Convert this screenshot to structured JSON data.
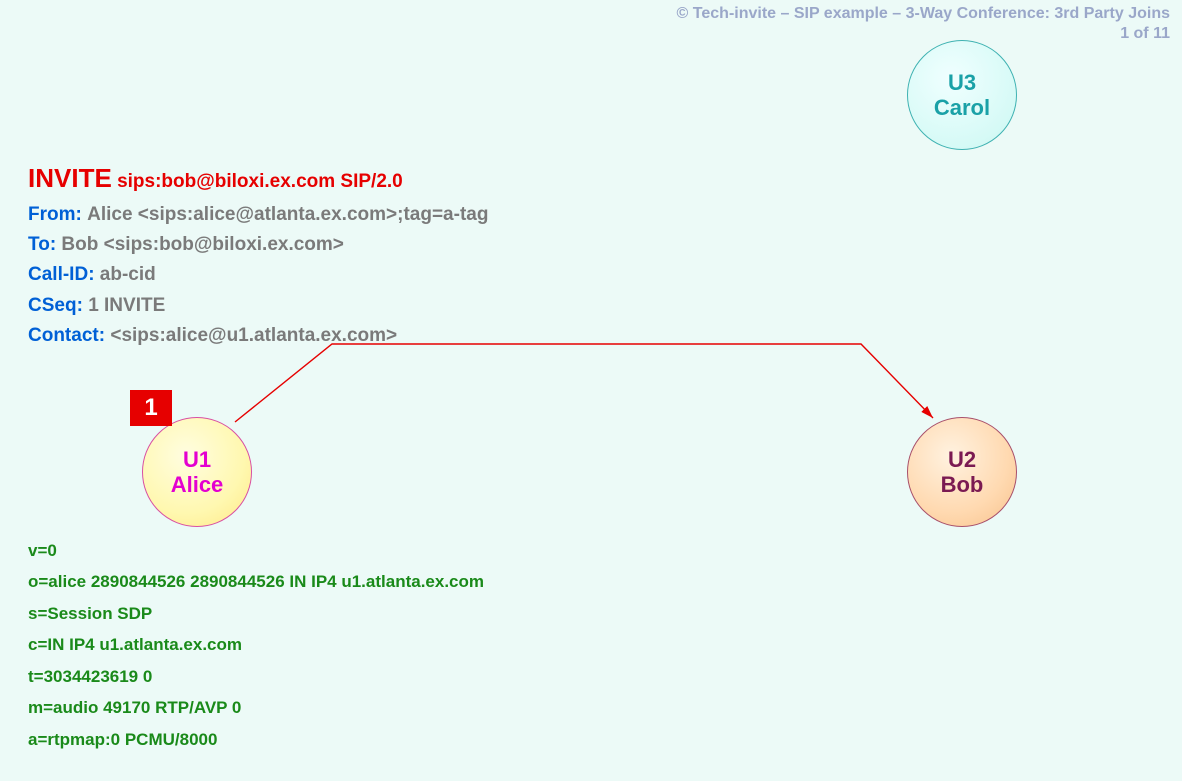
{
  "meta": {
    "copyright": "© Tech-invite – SIP example – 3-Way Conference: 3rd Party Joins",
    "page_of": "1 of 11"
  },
  "message": {
    "method": "INVITE",
    "request_uri": "sips:bob@biloxi.ex.com SIP/2.0",
    "headers": {
      "from": {
        "name": "From",
        "value": "Alice <sips:alice@atlanta.ex.com>;tag=a-tag"
      },
      "to": {
        "name": "To",
        "value": "Bob <sips:bob@biloxi.ex.com>"
      },
      "call_id": {
        "name": "Call-ID",
        "value": "ab-cid"
      },
      "cseq": {
        "name": "CSeq",
        "value": "1 INVITE"
      },
      "contact": {
        "name": "Contact",
        "value": "<sips:alice@u1.atlanta.ex.com>"
      }
    }
  },
  "sdp": {
    "v": "v=0",
    "o": "o=alice  2890844526  2890844526  IN  IP4  u1.atlanta.ex.com",
    "s": "s=Session SDP",
    "c": "c=IN  IP4  u1.atlanta.ex.com",
    "t": "t=3034423619  0",
    "m": "m=audio  49170  RTP/AVP  0",
    "a": "a=rtpmap:0  PCMU/8000"
  },
  "nodes": {
    "u1": {
      "id": "U1",
      "name": "Alice"
    },
    "u2": {
      "id": "U2",
      "name": "Bob"
    },
    "u3": {
      "id": "U3",
      "name": "Carol"
    }
  },
  "step": {
    "label": "1"
  },
  "arrow": {
    "color": "#e60000",
    "from": "U1",
    "to": "U2"
  }
}
